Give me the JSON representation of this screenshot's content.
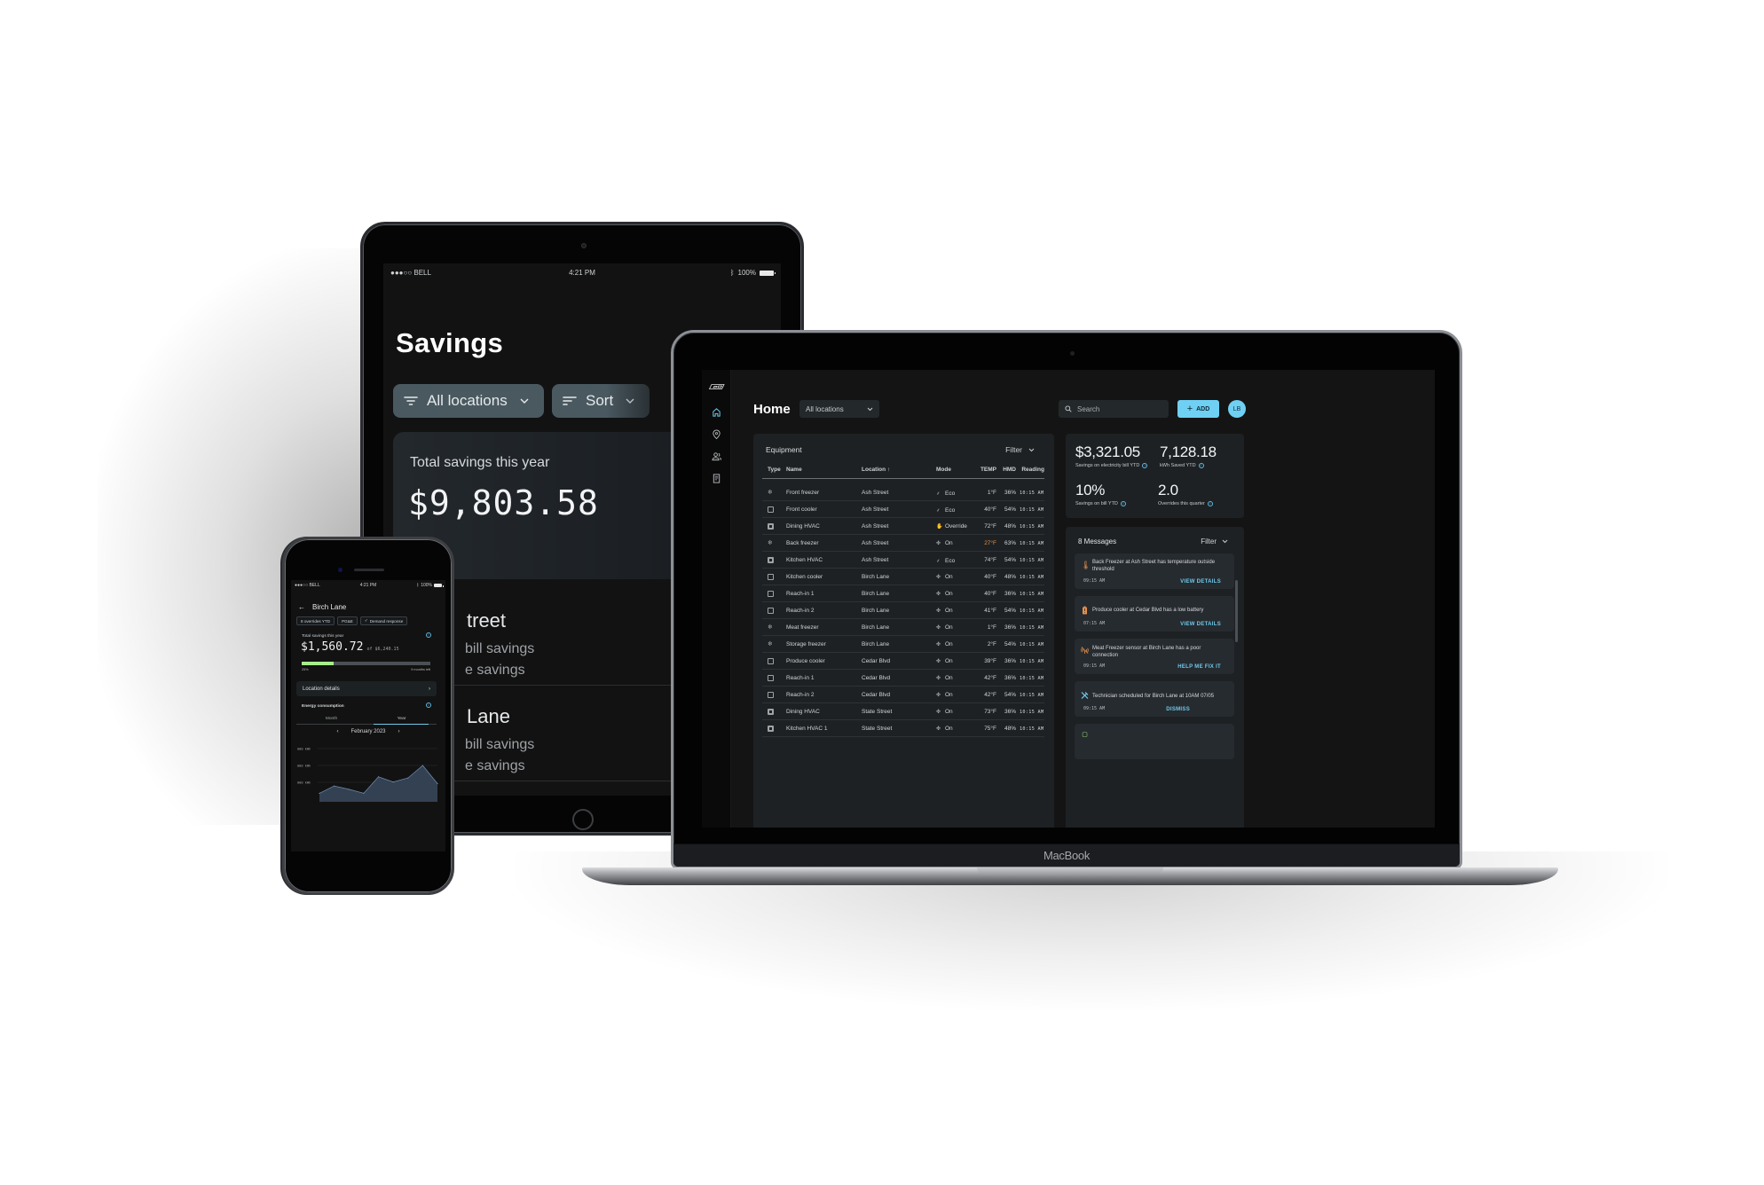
{
  "tablet": {
    "status": {
      "carrier": "●●●○○ BELL",
      "time": "4:21 PM",
      "battery": "100%"
    },
    "title": "Savings",
    "filters": [
      {
        "label": "All locations",
        "icon": "filter-icon"
      },
      {
        "label": "Sort",
        "icon": "sort-icon"
      }
    ],
    "total_card": {
      "label": "Total savings this year",
      "value": "$9,803.58"
    },
    "locations": [
      {
        "name": "Ash Street",
        "line1": "Electricity bill savings",
        "line2": "Demand response savings",
        "visible_name": "treet",
        "visible_line1": "bill savings",
        "visible_line2": "e savings"
      },
      {
        "name": "Birch Lane",
        "line1": "Electricity bill savings",
        "line2": "Demand response savings",
        "visible_name": "Lane",
        "visible_line1": "bill savings",
        "visible_line2": "e savings"
      }
    ]
  },
  "laptop": {
    "brand": "MacBook",
    "sidebar": {
      "items": [
        {
          "name": "home",
          "icon": "home-icon",
          "active": true
        },
        {
          "name": "locations",
          "icon": "location-pin-icon"
        },
        {
          "name": "users",
          "icon": "users-icon"
        },
        {
          "name": "reports",
          "icon": "document-icon"
        }
      ]
    },
    "header": {
      "title": "Home",
      "location_select": "All locations",
      "search_placeholder": "Search",
      "add_label": "ADD",
      "avatar_initials": "LB"
    },
    "equipment": {
      "title": "Equipment",
      "filter_label": "Filter",
      "columns": [
        "Type",
        "Name",
        "Location",
        "Mode",
        "TEMP",
        "HMD",
        "Reading"
      ],
      "sort_indicator": "↑",
      "rows": [
        {
          "type": "freezer",
          "name": "Front freezer",
          "location": "Ash Street",
          "mode": "Eco",
          "mode_icon": "eco-icon",
          "temp": "1°F",
          "hmd": "36%",
          "reading": "10:15 AM"
        },
        {
          "type": "cooler",
          "name": "Front cooler",
          "location": "Ash Street",
          "mode": "Eco",
          "mode_icon": "eco-icon",
          "temp": "40°F",
          "hmd": "54%",
          "reading": "10:15 AM"
        },
        {
          "type": "hvac",
          "name": "Dining HVAC",
          "location": "Ash Street",
          "mode": "Override",
          "mode_icon": "hand-icon",
          "temp": "72°F",
          "hmd": "48%",
          "reading": "10:15 AM"
        },
        {
          "type": "freezer",
          "name": "Back freezer",
          "location": "Ash Street",
          "mode": "On",
          "mode_icon": "fan-icon",
          "temp": "27°F",
          "temp_alert": true,
          "hmd": "63%",
          "reading": "10:15 AM"
        },
        {
          "type": "hvac",
          "name": "Kitchen HVAC",
          "location": "Ash Street",
          "mode": "Eco",
          "mode_icon": "eco-icon",
          "temp": "74°F",
          "hmd": "54%",
          "reading": "10:15 AM"
        },
        {
          "type": "cooler",
          "name": "Kitchen cooler",
          "location": "Birch Lane",
          "mode": "On",
          "mode_icon": "fan-icon",
          "temp": "40°F",
          "hmd": "48%",
          "reading": "10:15 AM"
        },
        {
          "type": "cooler",
          "name": "Reach-in 1",
          "location": "Birch Lane",
          "mode": "On",
          "mode_icon": "fan-icon",
          "temp": "40°F",
          "hmd": "36%",
          "reading": "10:15 AM"
        },
        {
          "type": "cooler",
          "name": "Reach-in 2",
          "location": "Birch Lane",
          "mode": "On",
          "mode_icon": "fan-icon",
          "temp": "41°F",
          "hmd": "54%",
          "reading": "10:15 AM"
        },
        {
          "type": "freezer",
          "name": "Meat freezer",
          "location": "Birch Lane",
          "mode": "On",
          "mode_icon": "fan-icon",
          "temp": "1°F",
          "hmd": "36%",
          "reading": "10:15 AM"
        },
        {
          "type": "freezer",
          "name": "Storage freezer",
          "location": "Birch Lane",
          "mode": "On",
          "mode_icon": "fan-icon",
          "temp": "2°F",
          "hmd": "54%",
          "reading": "10:15 AM"
        },
        {
          "type": "cooler",
          "name": "Produce cooler",
          "location": "Cedar Blvd",
          "mode": "On",
          "mode_icon": "fan-icon",
          "temp": "39°F",
          "hmd": "36%",
          "reading": "10:15 AM"
        },
        {
          "type": "cooler",
          "name": "Reach-in 1",
          "location": "Cedar Blvd",
          "mode": "On",
          "mode_icon": "fan-icon",
          "temp": "42°F",
          "hmd": "36%",
          "reading": "10:15 AM"
        },
        {
          "type": "cooler",
          "name": "Reach-in 2",
          "location": "Cedar Blvd",
          "mode": "On",
          "mode_icon": "fan-icon",
          "temp": "42°F",
          "hmd": "54%",
          "reading": "10:15 AM"
        },
        {
          "type": "hvac",
          "name": "Dining HVAC",
          "location": "State Street",
          "mode": "On",
          "mode_icon": "fan-icon",
          "temp": "73°F",
          "hmd": "36%",
          "reading": "10:15 AM"
        },
        {
          "type": "hvac",
          "name": "Kitchen HVAC 1",
          "location": "State Street",
          "mode": "On",
          "mode_icon": "fan-icon",
          "temp": "75°F",
          "hmd": "48%",
          "reading": "10:15 AM"
        }
      ]
    },
    "stats": [
      {
        "value": "$3,321.05",
        "label": "Savings on electricity bill YTD"
      },
      {
        "value": "7,128.18",
        "label": "kWh Saved YTD"
      },
      {
        "value": "10%",
        "label": "Savings on bill YTD"
      },
      {
        "value": "2.0",
        "label": "Overrides this quarter"
      }
    ],
    "messages": {
      "title": "8 Messages",
      "filter_label": "Filter",
      "items": [
        {
          "icon": "thermometer-alert-icon",
          "color": "#e8904a",
          "text": "Back Freezer at Ash Street has temperature outside threshold",
          "time": "09:15 AM",
          "action": "VIEW DETAILS"
        },
        {
          "icon": "battery-low-icon",
          "color": "#e8904a",
          "text": "Produce cooler at Cedar Blvd  has a low battery",
          "time": "07:15 AM",
          "action": "VIEW DETAILS"
        },
        {
          "icon": "signal-off-icon",
          "color": "#e8904a",
          "text": "Meat Freezer sensor at Birch Lane has a poor connection",
          "time": "09:15 AM",
          "action": "HELP ME FIX IT"
        },
        {
          "icon": "tools-icon",
          "color": "#6fc9ea",
          "text": "Technician scheduled for Birch Lane at 10AM 07/05",
          "time": "09:15 AM",
          "action": "DISMISS"
        }
      ]
    }
  },
  "phone": {
    "status": {
      "carrier": "●●●○○ BELL",
      "time": "4:21 PM",
      "battery": "100%"
    },
    "title": "Birch Lane",
    "chips": [
      "8 overrides YTD",
      "PG&E",
      "Demand response"
    ],
    "savings_label": "Total savings this year",
    "savings_value": "$1,560.72",
    "savings_of": "of $6,240.15",
    "progress_percent": 25,
    "progress_left_label": "25%",
    "progress_right_label": "9 months left",
    "location_details": "Location details",
    "energy_title": "Energy consumption",
    "tabs": [
      {
        "label": "Month",
        "active": false
      },
      {
        "label": "Year",
        "active": true
      }
    ],
    "period": "February 2023",
    "chart_ylabels": [
      "000 kWh",
      "000 kWh",
      "000 kWh"
    ],
    "chart_series": [
      0.15,
      0.28,
      0.22,
      0.15,
      0.44,
      0.35,
      0.42,
      0.64,
      0.32
    ]
  },
  "colors": {
    "accent": "#6fd0f4",
    "alert": "#e8904a",
    "progress": "#a6ee8a",
    "panel": "#1d2124"
  }
}
